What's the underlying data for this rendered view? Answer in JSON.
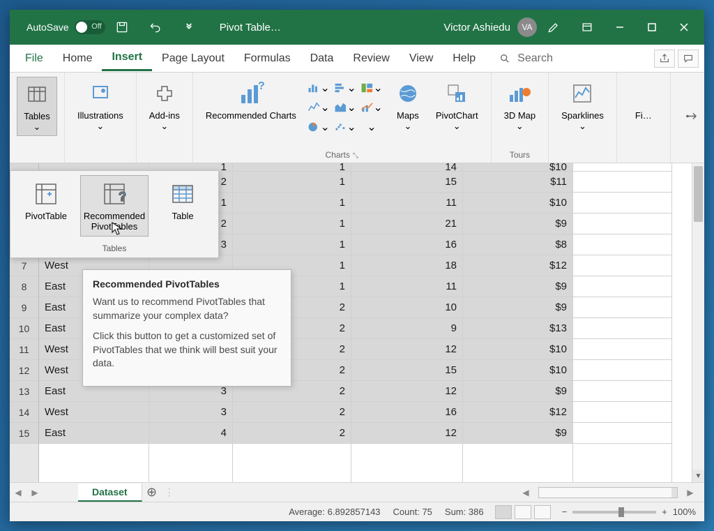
{
  "titlebar": {
    "autosave": "AutoSave",
    "autosave_state": "Off",
    "doc_title": "Pivot Table…",
    "user_name": "Victor Ashiedu",
    "user_initials": "VA"
  },
  "menu": {
    "file": "File",
    "home": "Home",
    "insert": "Insert",
    "page_layout": "Page Layout",
    "formulas": "Formulas",
    "data": "Data",
    "review": "Review",
    "view": "View",
    "help": "Help",
    "search": "Search"
  },
  "ribbon": {
    "tables": "Tables",
    "illustrations": "Illustrations",
    "addins": "Add-ins",
    "recommended_charts": "Recommended Charts",
    "maps": "Maps",
    "pivotchart": "PivotChart",
    "map3d": "3D Map",
    "sparklines": "Sparklines",
    "filters": "Fi…",
    "charts_group": "Charts",
    "tours_group": "Tours"
  },
  "tables_dropdown": {
    "pivottable": "PivotTable",
    "recommended": "Recommended PivotTables",
    "table": "Table",
    "group_label": "Tables"
  },
  "tooltip": {
    "title": "Recommended PivotTables",
    "p1": "Want us to recommend PivotTables that summarize your complex data?",
    "p2": "Click this button to get a customized set of PivotTables that we think will best suit your data."
  },
  "sheet": {
    "rows_visible": [
      {
        "n": "",
        "a": "",
        "b": "1",
        "c": "1",
        "d": "14",
        "e": "$10"
      },
      {
        "n": "",
        "a": "",
        "b": "2",
        "c": "1",
        "d": "15",
        "e": "$11"
      },
      {
        "n": "",
        "a": "",
        "b": "1",
        "c": "1",
        "d": "11",
        "e": "$10"
      },
      {
        "n": "",
        "a": "",
        "b": "2",
        "c": "1",
        "d": "21",
        "e": "$9"
      },
      {
        "n": "",
        "a": "",
        "b": "3",
        "c": "1",
        "d": "16",
        "e": "$8"
      },
      {
        "n": "7",
        "a": "West",
        "b": "",
        "c": "1",
        "d": "18",
        "e": "$12"
      },
      {
        "n": "8",
        "a": "East",
        "b": "",
        "c": "1",
        "d": "11",
        "e": "$9"
      },
      {
        "n": "9",
        "a": "East",
        "b": "",
        "c": "2",
        "d": "10",
        "e": "$9"
      },
      {
        "n": "10",
        "a": "East",
        "b": "",
        "c": "2",
        "d": "9",
        "e": "$13"
      },
      {
        "n": "11",
        "a": "West",
        "b": "",
        "c": "2",
        "d": "12",
        "e": "$10"
      },
      {
        "n": "12",
        "a": "West",
        "b": "",
        "c": "2",
        "d": "15",
        "e": "$10"
      },
      {
        "n": "13",
        "a": "East",
        "b": "3",
        "c": "2",
        "d": "12",
        "e": "$9"
      },
      {
        "n": "14",
        "a": "West",
        "b": "3",
        "c": "2",
        "d": "16",
        "e": "$12"
      },
      {
        "n": "15",
        "a": "East",
        "b": "4",
        "c": "2",
        "d": "12",
        "e": "$9"
      }
    ],
    "tab": "Dataset"
  },
  "status": {
    "average": "Average: 6.892857143",
    "count": "Count: 75",
    "sum": "Sum: 386",
    "zoom": "100%"
  }
}
